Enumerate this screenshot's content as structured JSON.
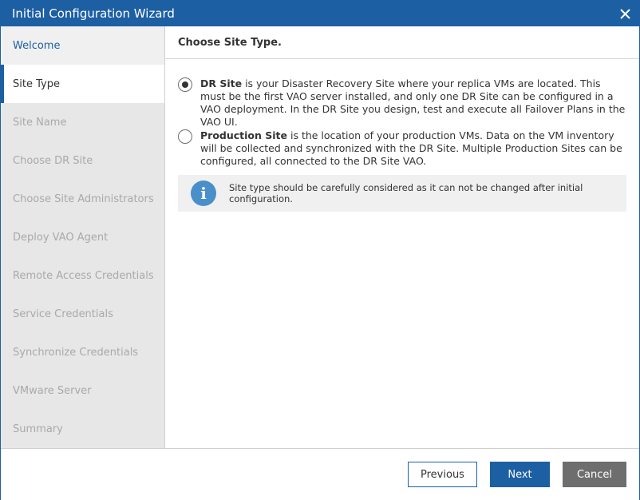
{
  "window": {
    "title": "Initial Configuration Wizard",
    "close_icon": "close-icon"
  },
  "steps": [
    {
      "label": "Welcome",
      "state": "done"
    },
    {
      "label": "Site Type",
      "state": "active"
    },
    {
      "label": "Site Name",
      "state": "disabled"
    },
    {
      "label": "Choose DR Site",
      "state": "disabled"
    },
    {
      "label": "Choose Site Administrators",
      "state": "disabled"
    },
    {
      "label": "Deploy VAO Agent",
      "state": "disabled"
    },
    {
      "label": "Remote Access Credentials",
      "state": "disabled"
    },
    {
      "label": "Service Credentials",
      "state": "disabled"
    },
    {
      "label": "Synchronize Credentials",
      "state": "disabled"
    },
    {
      "label": "VMware Server",
      "state": "disabled"
    },
    {
      "label": "Summary",
      "state": "disabled"
    }
  ],
  "content": {
    "heading": "Choose Site Type.",
    "options": [
      {
        "name": "DR Site",
        "selected": true,
        "description": " is your Disaster Recovery Site where your replica VMs are located. This must be the first VAO server installed, and only one DR Site can be configured in a VAO deployment. In the DR Site you design, test and execute all Failover Plans in the VAO UI."
      },
      {
        "name": "Production Site",
        "selected": false,
        "description": " is the location of your production VMs. Data on the VM inventory will be collected and synchronized with the DR Site. Multiple Production Sites can be configured, all connected to the DR Site VAO."
      }
    ],
    "info": {
      "icon": "info-icon",
      "text": "Site type should be carefully considered as it can not be changed after initial configuration."
    }
  },
  "footer": {
    "previous": "Previous",
    "next": "Next",
    "cancel": "Cancel"
  },
  "colors": {
    "accent": "#1d5fa3",
    "cancel": "#6e6e6e",
    "info_icon": "#4a8fc9"
  }
}
